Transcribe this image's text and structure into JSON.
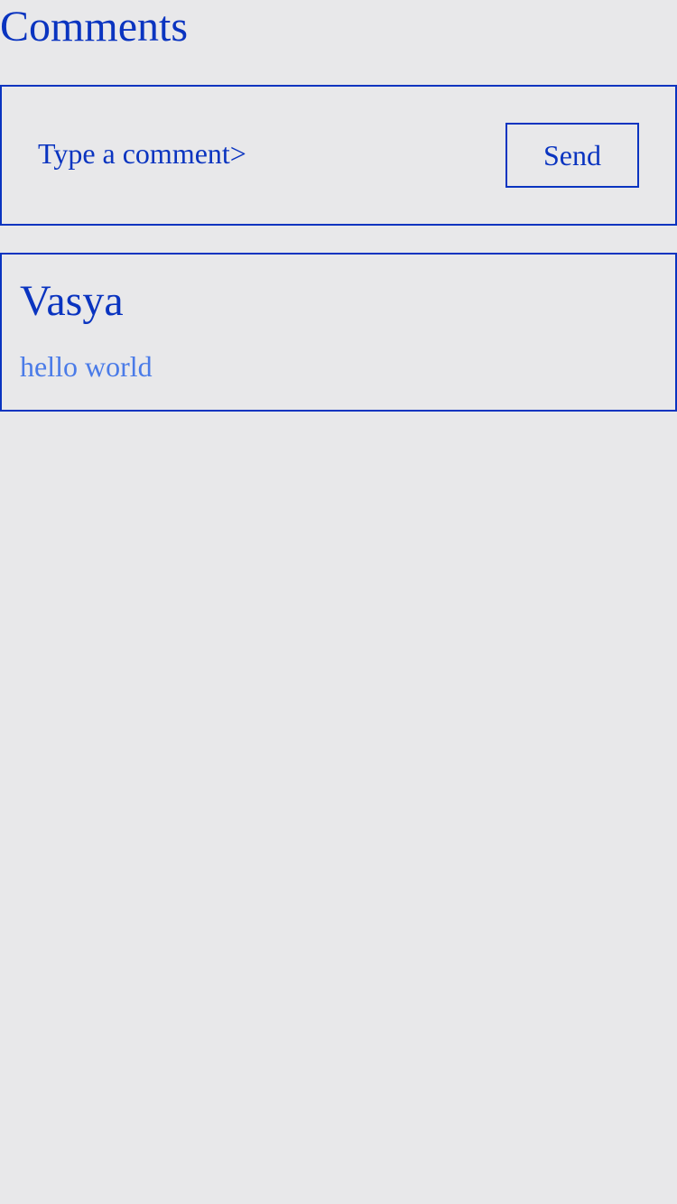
{
  "page": {
    "title": "Comments"
  },
  "composer": {
    "placeholder": "Type a comment>",
    "value": "",
    "send_label": "Send"
  },
  "comments": [
    {
      "author": "Vasya",
      "text": "hello world"
    }
  ],
  "colors": {
    "background": "#e8e8ea",
    "primary": "#0a34c0",
    "comment_text": "#4a7be8"
  }
}
